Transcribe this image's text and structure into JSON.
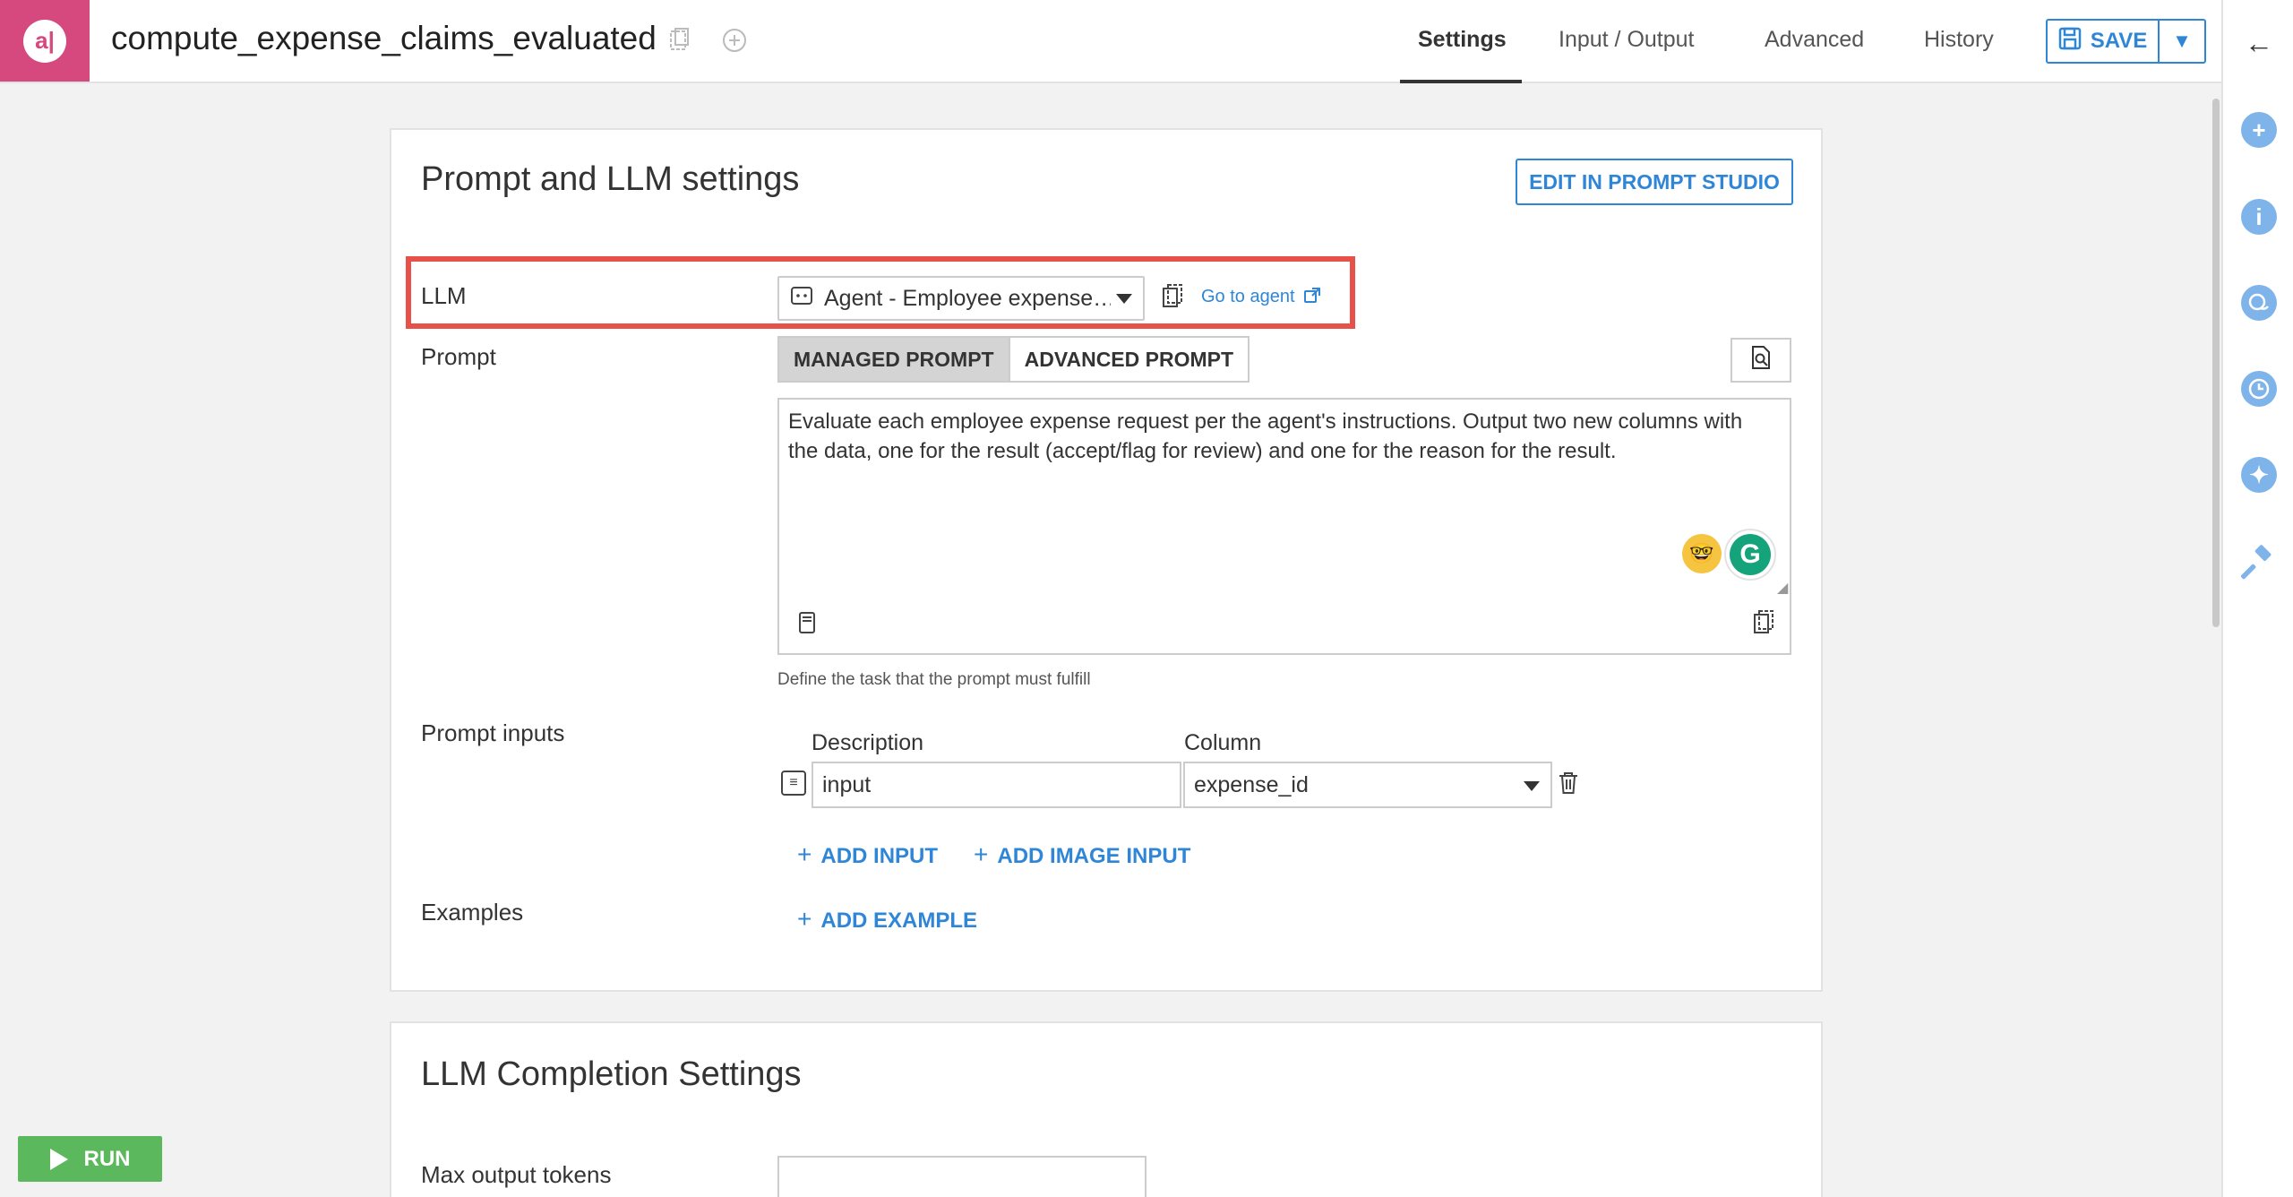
{
  "app": {
    "logo_text": "a|",
    "recipe_name": "compute_expense_claims_evaluated"
  },
  "header": {
    "tabs": [
      {
        "label": "Settings",
        "active": true
      },
      {
        "label": "Input / Output",
        "active": false
      },
      {
        "label": "Advanced",
        "active": false
      },
      {
        "label": "History",
        "active": false
      }
    ],
    "save_label": "SAVE"
  },
  "prompt_card": {
    "title": "Prompt and LLM settings",
    "edit_button": "EDIT IN PROMPT STUDIO",
    "llm": {
      "label": "LLM",
      "selected": "Agent - Employee expense…",
      "goto_link": "Go to agent"
    },
    "prompt": {
      "label": "Prompt",
      "mode_tabs": [
        "MANAGED PROMPT",
        "ADVANCED PROMPT"
      ],
      "active_mode": "MANAGED PROMPT",
      "text": "Evaluate each employee expense request per the agent's instructions. Output two new columns with the data, one for the result (accept/flag for review) and one for the reason for the result.",
      "helper": "Define the task that the prompt must fulfill"
    },
    "inputs": {
      "label": "Prompt inputs",
      "description_header": "Description",
      "column_header": "Column",
      "rows": [
        {
          "description": "input",
          "column": "expense_id"
        }
      ],
      "add_input": "ADD INPUT",
      "add_image_input": "ADD IMAGE INPUT"
    },
    "examples": {
      "label": "Examples",
      "add_example": "ADD EXAMPLE"
    }
  },
  "completion_card": {
    "title": "LLM Completion Settings",
    "max_tokens_label": "Max output tokens",
    "max_tokens_value": ""
  },
  "run_button": "RUN",
  "colors": {
    "accent": "#2f86d6",
    "brand": "#d6497f",
    "run": "#5cb85c",
    "highlight": "#e8514a"
  }
}
